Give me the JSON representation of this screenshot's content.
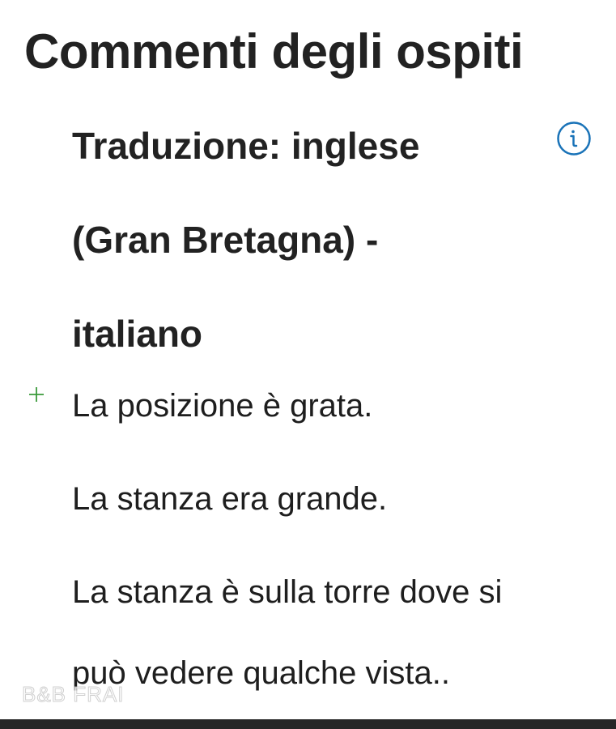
{
  "page": {
    "title": "Commenti degli ospiti"
  },
  "translation": {
    "heading_lines": [
      "Traduzione: inglese",
      "(Gran Bretagna) -",
      "italiano"
    ],
    "info_icon": "info-circle-icon",
    "accent_color": "#1a73b8"
  },
  "review": {
    "marker_icon": "plus-icon",
    "marker_color": "#3a9a3a",
    "lines": [
      "La posizione è grata.",
      "La stanza era grande.",
      "La stanza è sulla torre dove si",
      "può vedere qualche vista.."
    ]
  },
  "watermark": {
    "text": "B&B FRAI"
  }
}
